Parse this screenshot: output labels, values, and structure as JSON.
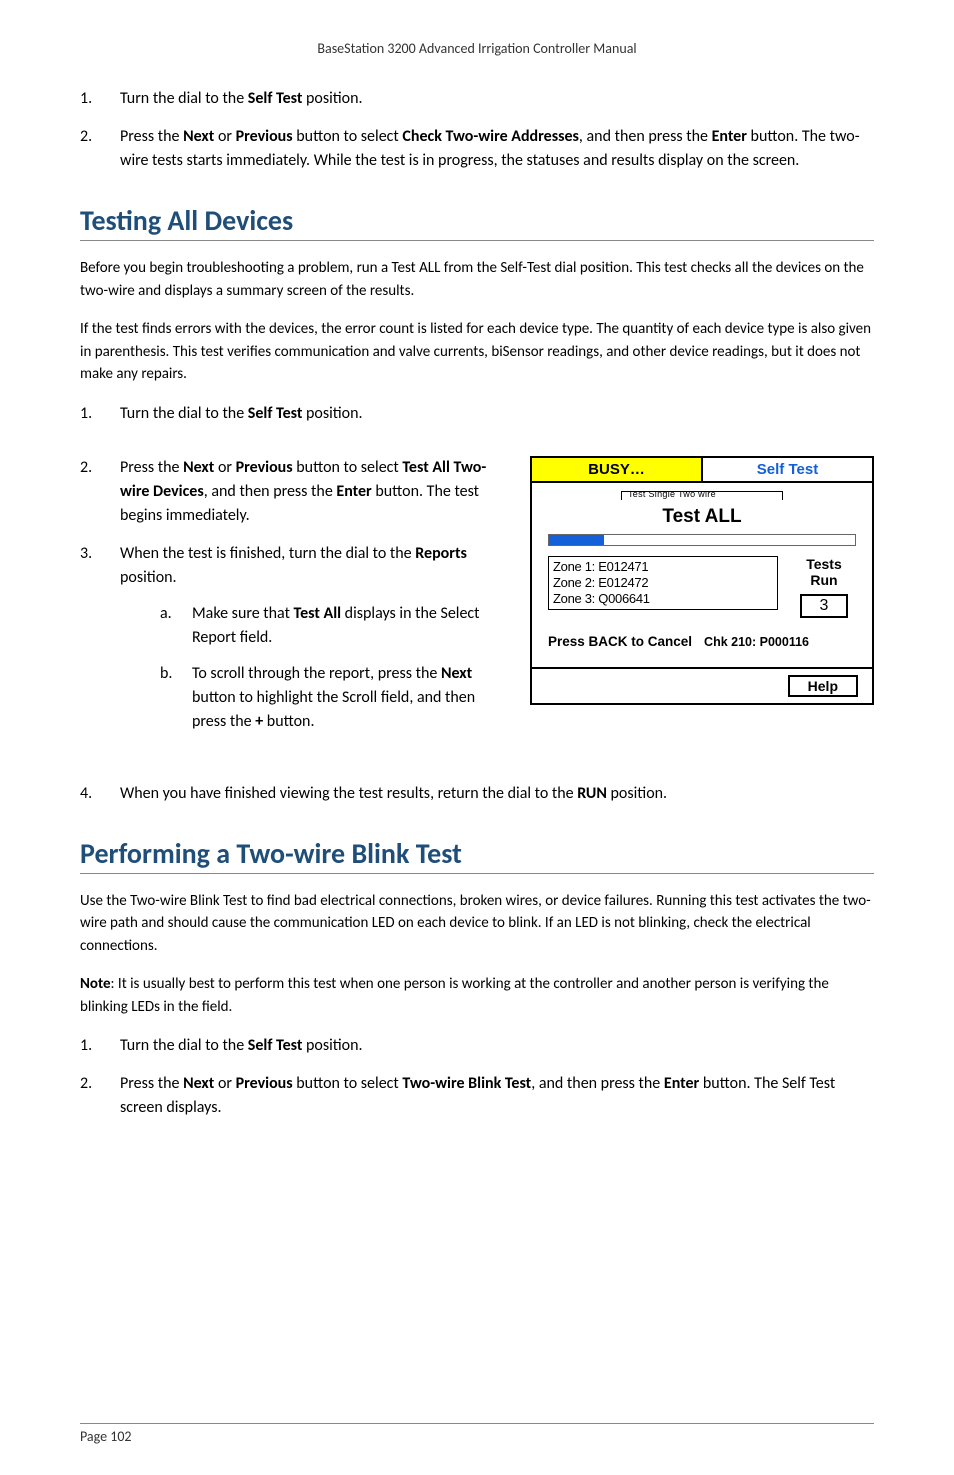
{
  "header": {
    "title": "BaseStation 3200 Advanced Irrigation Controller Manual"
  },
  "top_steps": {
    "s1": {
      "num": "1.",
      "text_a": "Turn the dial to the ",
      "bold_a": "Self Test",
      "text_b": " position."
    },
    "s2": {
      "num": "2.",
      "p1": "Press the ",
      "b1": "Next",
      "p2": " or ",
      "b2": "Previous",
      "p3": " button to select ",
      "b3": "Check Two-wire Addresses",
      "p4": ", and then press the ",
      "b4": "Enter",
      "p5": " button. The two-wire tests starts immediately. While the test is in progress, the statuses and results display on the screen."
    }
  },
  "sec1": {
    "title": "Testing All Devices",
    "para1": "Before you begin troubleshooting a problem, run a Test ALL from the Self-Test dial position. This test checks all the devices on the two-wire and displays a summary screen of the results.",
    "para2": "If the test finds errors with the devices, the error count is listed for each device type. The quantity of each device type is also given in parenthesis. This test verifies communication and valve currents, biSensor readings, and other device readings, but it does not make any repairs.",
    "steps": {
      "s1": {
        "num": "1.",
        "text_a": "Turn the dial to the ",
        "bold_a": "Self Test",
        "text_b": " position."
      },
      "s2": {
        "num": "2.",
        "p1": "Press the ",
        "b1": "Next",
        "p2": " or ",
        "b2": "Previous",
        "p3": " button to select ",
        "b3": "Test All Two-wire Devices",
        "p4": ", and then press the ",
        "b4": "Enter",
        "p5": " button. The test begins immediately."
      },
      "s3": {
        "num": "3.",
        "text_a": "When the test is finished, turn the dial to the ",
        "bold_a": "Reports",
        "text_b": " position.",
        "sub": {
          "a": {
            "letter": "a.",
            "p1": "Make sure that ",
            "b1": "Test All",
            "p2": " displays in the Select Report field."
          },
          "b": {
            "letter": "b.",
            "p1": "To scroll through the report, press the ",
            "b1": "Next",
            "p2": " button to highlight the Scroll field, and then press the ",
            "b2": "+",
            "p3": " button."
          }
        }
      },
      "s4": {
        "num": "4.",
        "p1": "When you have finished viewing the test results, return the dial to the ",
        "b1": "RUN",
        "p2": " position."
      }
    }
  },
  "device": {
    "tab_busy": "BUSY…",
    "tab_selftest": "Self Test",
    "hairline": "Test Single Two wire",
    "title": "Test ALL",
    "zone1": "Zone 1: E012471",
    "zone2": "Zone 2: E012472",
    "zone3": "Zone 3: Q006641",
    "tests_label": "Tests",
    "run_label": "Run",
    "count": "3",
    "cancel": "Press BACK to Cancel",
    "chk": "Chk 210: P000116",
    "help": "Help"
  },
  "sec2": {
    "title": "Performing a Two-wire Blink Test",
    "para1": "Use the Two-wire Blink Test to find bad electrical connections, broken wires, or device failures. Running this test activates the two-wire path and should cause the communication LED on each device to blink. If an LED is not blinking, check the electrical connections.",
    "note_b": "Note",
    "note_rest": ": It is usually best to perform this test when one person is working at the controller and another person is verifying the blinking LEDs in the field.",
    "steps": {
      "s1": {
        "num": "1.",
        "text_a": "Turn the dial to the ",
        "bold_a": "Self Test",
        "text_b": " position."
      },
      "s2": {
        "num": "2.",
        "p1": "Press the ",
        "b1": "Next",
        "p2": " or ",
        "b2": "Previous",
        "p3": " button to select ",
        "b3": "Two-wire Blink Test",
        "p4": ", and then press the ",
        "b4": "Enter",
        "p5": " button. The Self Test screen displays."
      }
    }
  },
  "footer": {
    "page_label": "Page 102"
  }
}
